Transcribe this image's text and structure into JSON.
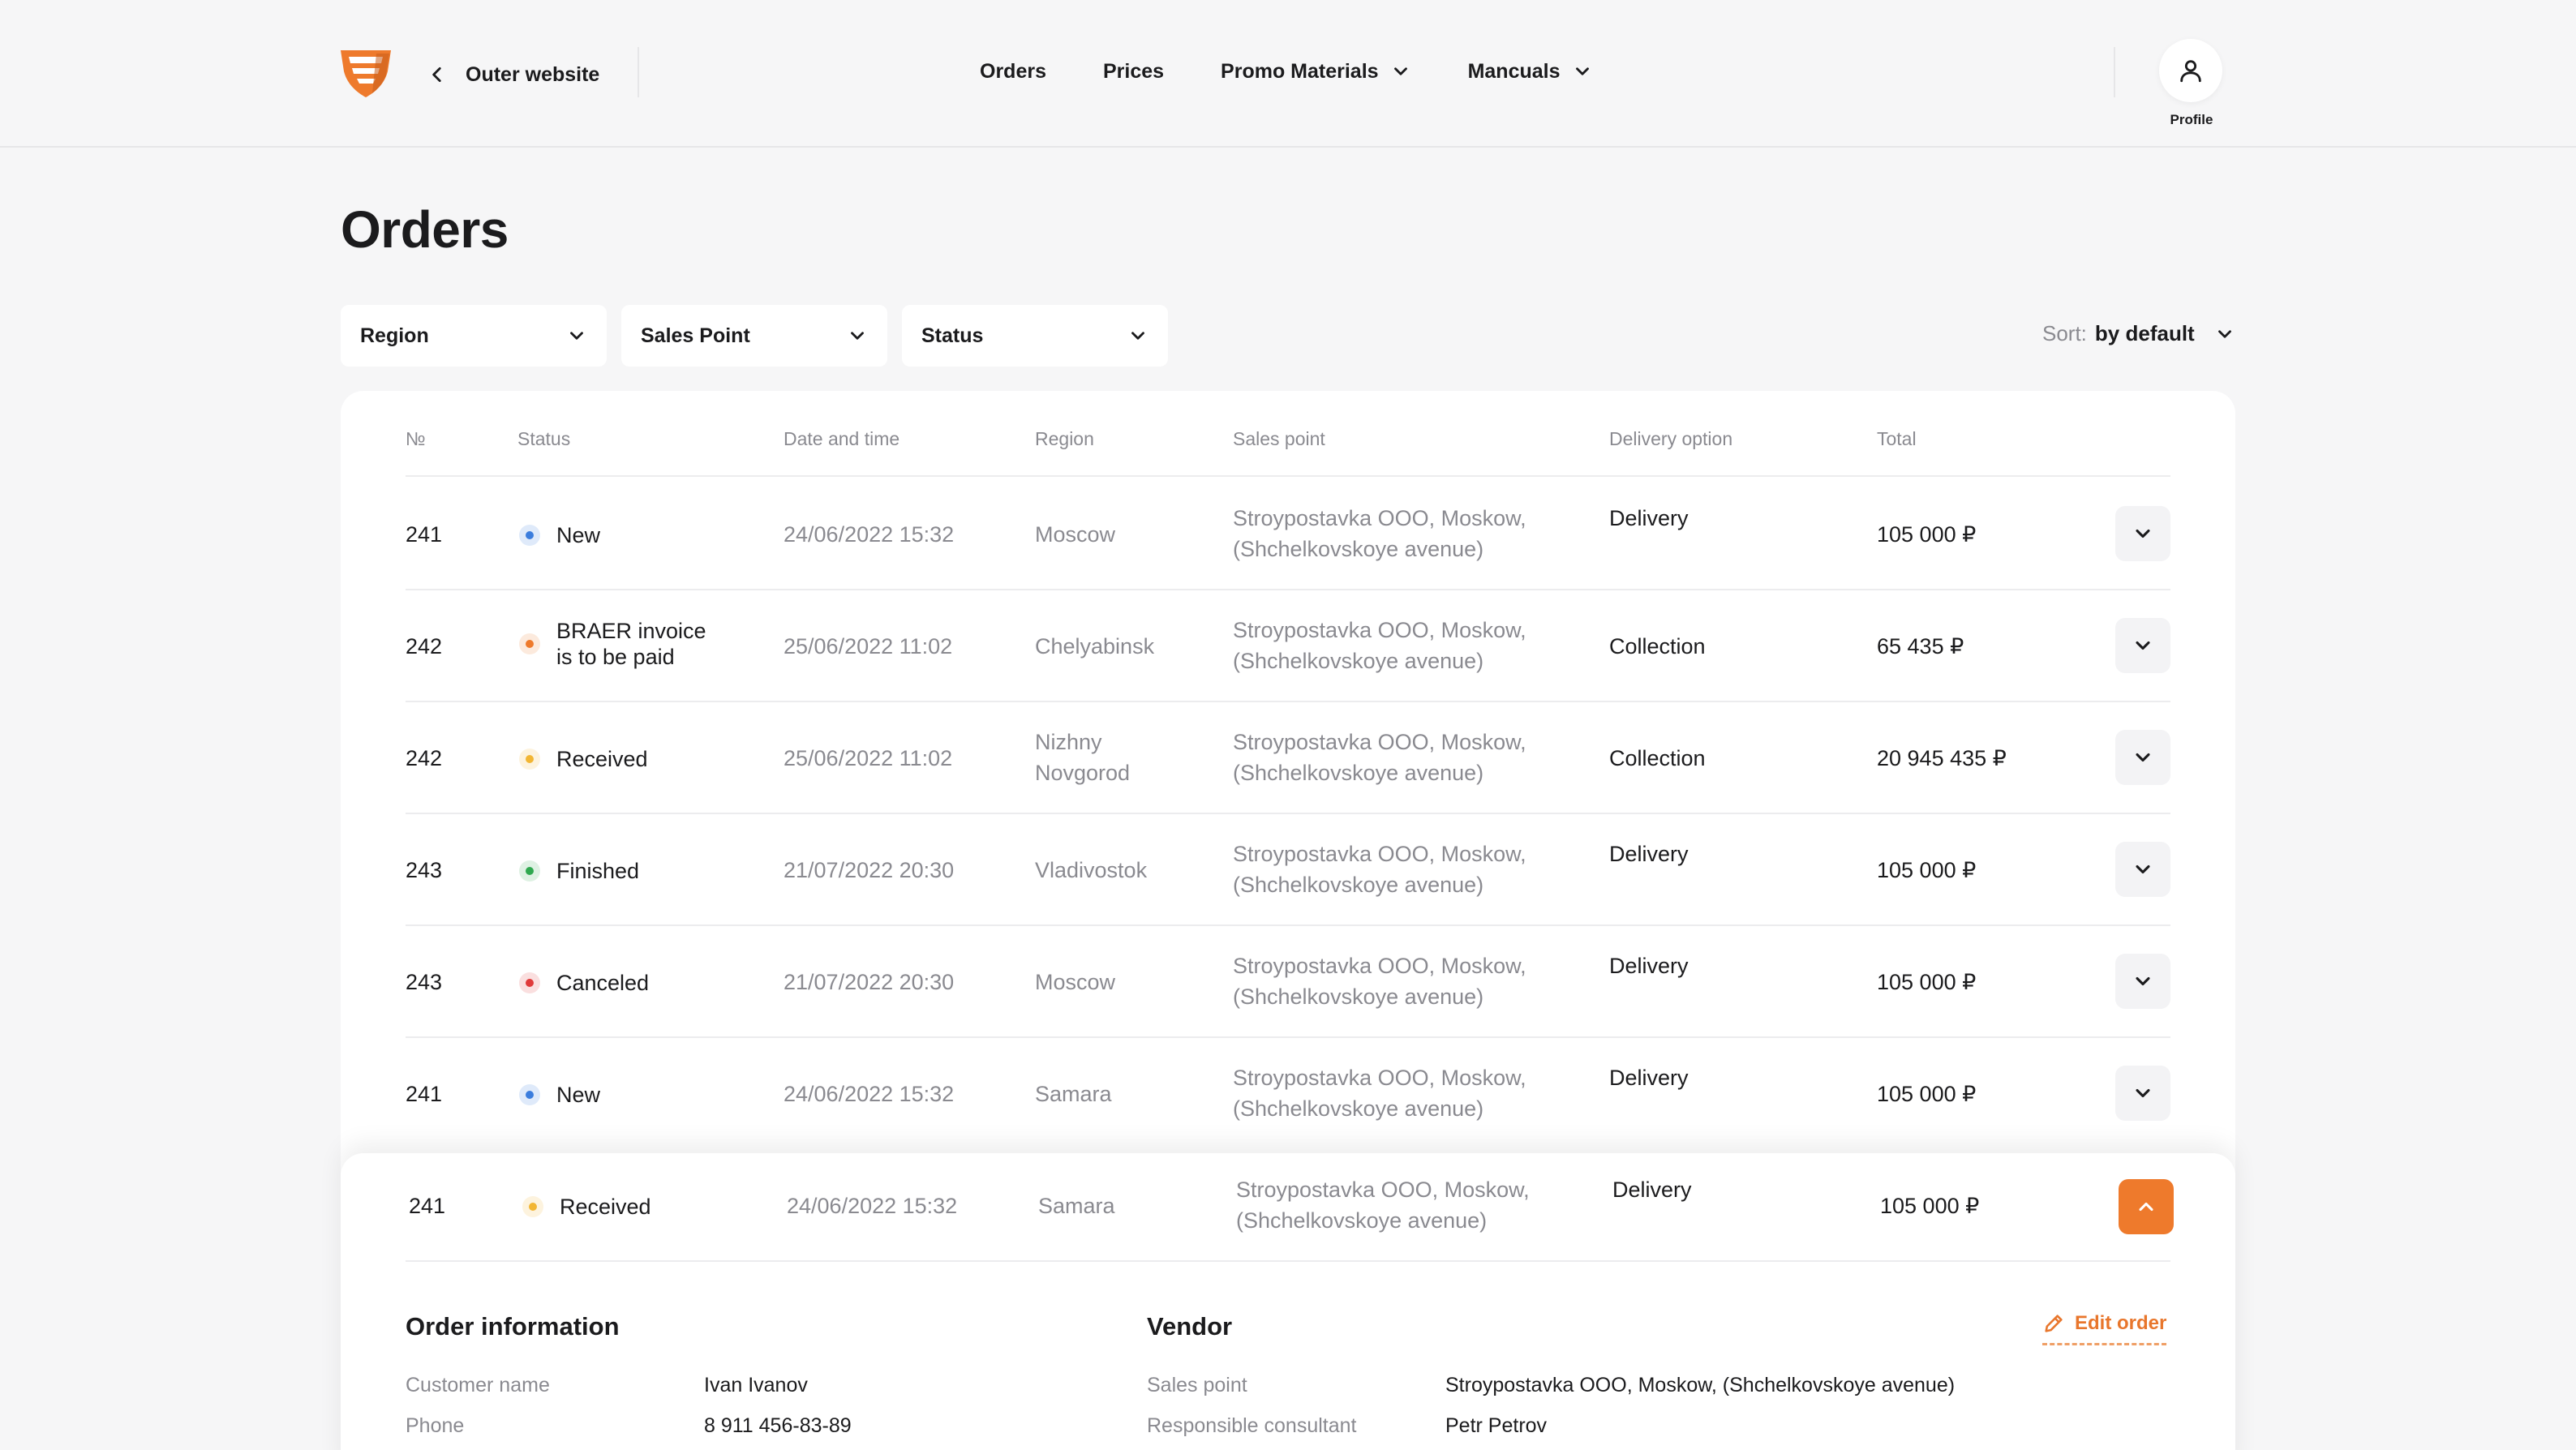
{
  "header": {
    "back_label": "Outer website",
    "nav": [
      {
        "label": "Orders",
        "has_dropdown": false
      },
      {
        "label": "Prices",
        "has_dropdown": false
      },
      {
        "label": "Promo Materials",
        "has_dropdown": true
      },
      {
        "label": "Mancuals",
        "has_dropdown": true
      }
    ],
    "profile_label": "Profile",
    "brand_color": "#ee7a2c"
  },
  "page": {
    "title": "Orders",
    "filters": [
      {
        "label": "Region"
      },
      {
        "label": "Sales Point"
      },
      {
        "label": "Status"
      }
    ],
    "sort": {
      "key": "Sort:",
      "value": "by default"
    }
  },
  "table": {
    "headers": [
      "№",
      "Status",
      "Date and time",
      "Region",
      "Sales point",
      "Delivery option",
      "Total"
    ],
    "rows": [
      {
        "num": "241",
        "status": "New",
        "status_color": "#3b7ddd",
        "date": "24/06/2022 15:32",
        "region": "Moscow",
        "sales_point_1": "Stroypostavka OOO, Moskow,",
        "sales_point_2": "(Shchelkovskoye avenue)",
        "delivery": "Delivery",
        "total": "105 000 ₽"
      },
      {
        "num": "242",
        "status": "BRAER invoice",
        "status_2": "is to be paid",
        "status_color": "#ee7a2c",
        "date": "25/06/2022 11:02",
        "region": "Chelyabinsk",
        "sales_point_1": "Stroypostavka OOO, Moskow,",
        "sales_point_2": "(Shchelkovskoye avenue)",
        "delivery": "Collection",
        "total": "65 435 ₽"
      },
      {
        "num": "242",
        "status": "Received",
        "status_color": "#f2b634",
        "date": "25/06/2022 11:02",
        "region": "Nizhny",
        "region_2": "Novgorod",
        "sales_point_1": "Stroypostavka OOO, Moskow,",
        "sales_point_2": "(Shchelkovskoye avenue)",
        "delivery": "Collection",
        "total": "20 945 435 ₽"
      },
      {
        "num": "243",
        "status": "Finished",
        "status_color": "#2fa84f",
        "date": "21/07/2022 20:30",
        "region": "Vladivostok",
        "sales_point_1": "Stroypostavka OOO, Moskow,",
        "sales_point_2": "(Shchelkovskoye avenue)",
        "delivery": "Delivery",
        "total": "105 000 ₽"
      },
      {
        "num": "243",
        "status": "Canceled",
        "status_color": "#e03a3a",
        "date": "21/07/2022 20:30",
        "region": "Moscow",
        "sales_point_1": "Stroypostavka OOO, Moskow,",
        "sales_point_2": "(Shchelkovskoye avenue)",
        "delivery": "Delivery",
        "total": "105 000 ₽"
      },
      {
        "num": "241",
        "status": "New",
        "status_color": "#3b7ddd",
        "date": "24/06/2022 15:32",
        "region": "Samara",
        "sales_point_1": "Stroypostavka OOO, Moskow,",
        "sales_point_2": "(Shchelkovskoye avenue)",
        "delivery": "Delivery",
        "total": "105 000 ₽"
      }
    ],
    "expanded_row": {
      "num": "241",
      "status": "Received",
      "status_color": "#f2b634",
      "date": "24/06/2022 15:32",
      "region": "Samara",
      "sales_point_1": "Stroypostavka OOO, Moskow,",
      "sales_point_2": "(Shchelkovskoye avenue)",
      "delivery": "Delivery",
      "total": "105 000 ₽"
    }
  },
  "details": {
    "order_info_title": "Order information",
    "order_info": [
      {
        "key": "Customer name",
        "value": "Ivan Ivanov"
      },
      {
        "key": "Phone",
        "value": "8 911 456-83-89"
      }
    ],
    "vendor_title": "Vendor",
    "vendor": [
      {
        "key": "Sales point",
        "value": "Stroypostavka OOO, Moskow, (Shchelkovskoye avenue)"
      },
      {
        "key": "Responsible consultant",
        "value": "Petr Petrov"
      }
    ],
    "edit_label": "Edit order"
  }
}
